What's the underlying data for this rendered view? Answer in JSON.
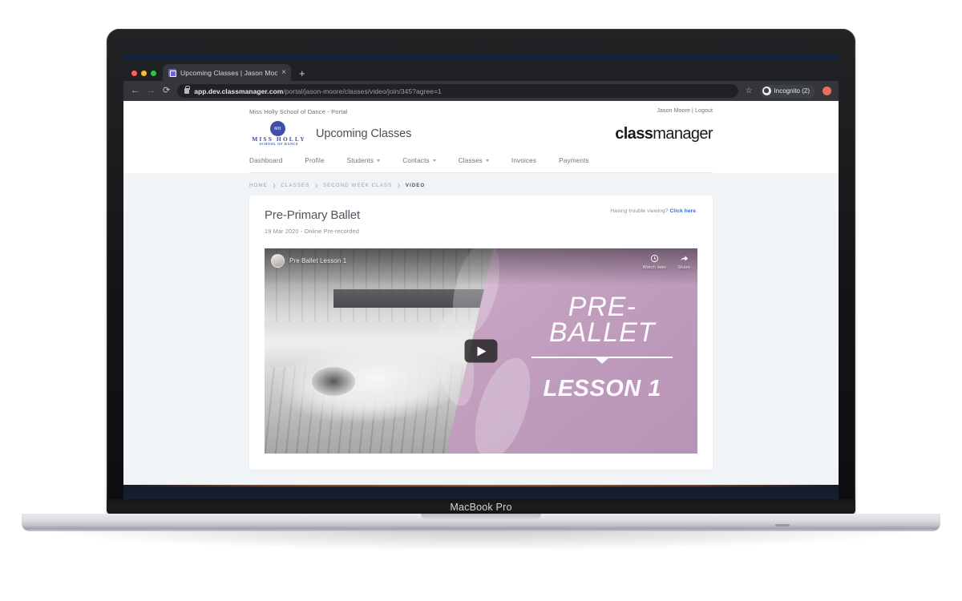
{
  "device": {
    "model_label": "MacBook Pro"
  },
  "browser": {
    "tab_title": "Upcoming Classes | Jason Moo",
    "tab_close": "×",
    "new_tab": "+",
    "back_icon": "←",
    "forward_icon": "→",
    "reload_icon": "⟳",
    "url_domain": "app.dev.classmanager.com",
    "url_path": "/portal/jason-moore/classes/video/join/345?agree=1",
    "bookmark_icon": "☆",
    "incognito_label": "Incognito (2)"
  },
  "site": {
    "portal_line": "Miss Holly School of Dance - Portal",
    "user_line": "Jason Moore | Logout",
    "logo": {
      "badge": "MH",
      "word": "MISS HOLLY",
      "sub": "SCHOOL OF DANCE"
    },
    "page_title": "Upcoming Classes",
    "product_logo": {
      "bold": "class",
      "light": "manager"
    },
    "nav": [
      {
        "label": "Dashboard",
        "has_caret": false
      },
      {
        "label": "Profile",
        "has_caret": false
      },
      {
        "label": "Students",
        "has_caret": true
      },
      {
        "label": "Contacts",
        "has_caret": true
      },
      {
        "label": "Classes",
        "has_caret": true
      },
      {
        "label": "Invoices",
        "has_caret": false
      },
      {
        "label": "Payments",
        "has_caret": false
      }
    ]
  },
  "breadcrumb": {
    "separator": "❯",
    "items": [
      "HOME",
      "CLASSES",
      "SECOND WEEK CLASS",
      "VIDEO"
    ]
  },
  "card": {
    "title": "Pre-Primary Ballet",
    "subtitle": "19 Mar 2020 - Online Pre-recorded",
    "trouble_text": "Having trouble viewing?",
    "trouble_link": "Click here",
    "trouble_suffix": "."
  },
  "video": {
    "yt_title": "Pre Ballet Lesson 1",
    "watch_later_label": "Watch later",
    "share_label": "Share",
    "overlay_line1": "PRE-",
    "overlay_line2": "BALLET",
    "overlay_lesson": "LESSON 1"
  },
  "colors": {
    "brand_blue": "#3f51a5",
    "link_blue": "#2f6fd0",
    "page_bg": "#f1f4f7",
    "overlay_purple": "#bf9bbc",
    "chrome_dark": "#202124"
  }
}
